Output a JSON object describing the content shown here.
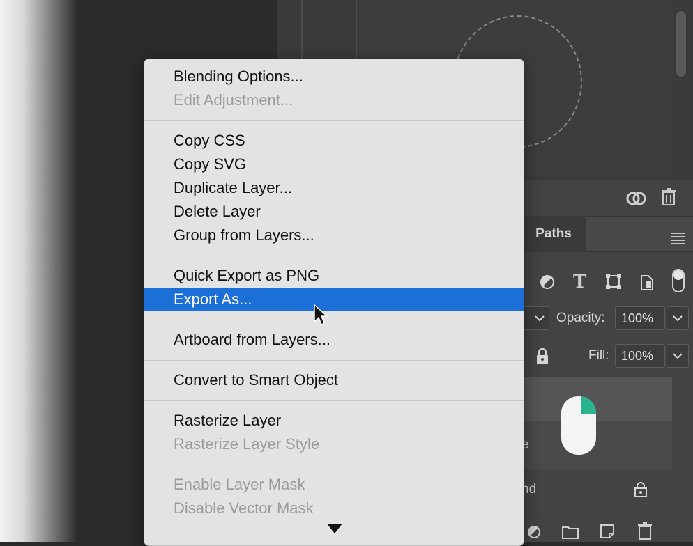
{
  "context_menu": {
    "items": [
      {
        "label": "Blending Options...",
        "enabled": true
      },
      {
        "label": "Edit Adjustment...",
        "enabled": false
      },
      {
        "label": "Copy CSS",
        "enabled": true
      },
      {
        "label": "Copy SVG",
        "enabled": true
      },
      {
        "label": "Duplicate Layer...",
        "enabled": true
      },
      {
        "label": "Delete Layer",
        "enabled": true
      },
      {
        "label": "Group from Layers...",
        "enabled": true
      },
      {
        "label": "Quick Export as PNG",
        "enabled": true
      },
      {
        "label": "Export As...",
        "enabled": true,
        "highlighted": true
      },
      {
        "label": "Artboard from Layers...",
        "enabled": true
      },
      {
        "label": "Convert to Smart Object",
        "enabled": true
      },
      {
        "label": "Rasterize Layer",
        "enabled": true
      },
      {
        "label": "Rasterize Layer Style",
        "enabled": false
      },
      {
        "label": "Enable Layer Mask",
        "enabled": false
      },
      {
        "label": "Disable Vector Mask",
        "enabled": false
      }
    ],
    "highlight_color": "#1d6fd8"
  },
  "layers_panel": {
    "tab_label": "Paths",
    "opacity_label": "Opacity:",
    "opacity_value": "100%",
    "fill_label": "Fill:",
    "fill_value": "100%",
    "layer_name_partial_1": "e",
    "layer_name_partial_2": "nd",
    "accent_color": "#2bb38d"
  },
  "icons": {
    "cc_libraries": "creative-cloud-icon",
    "trash": "trash-icon",
    "panel_menu": "panel-menu-icon",
    "filter_adjustment": "adjustment-filter-icon",
    "filter_type": "type-filter-icon",
    "filter_shape": "shape-filter-icon",
    "filter_smart": "smart-object-filter-icon",
    "lock": "lock-icon"
  }
}
